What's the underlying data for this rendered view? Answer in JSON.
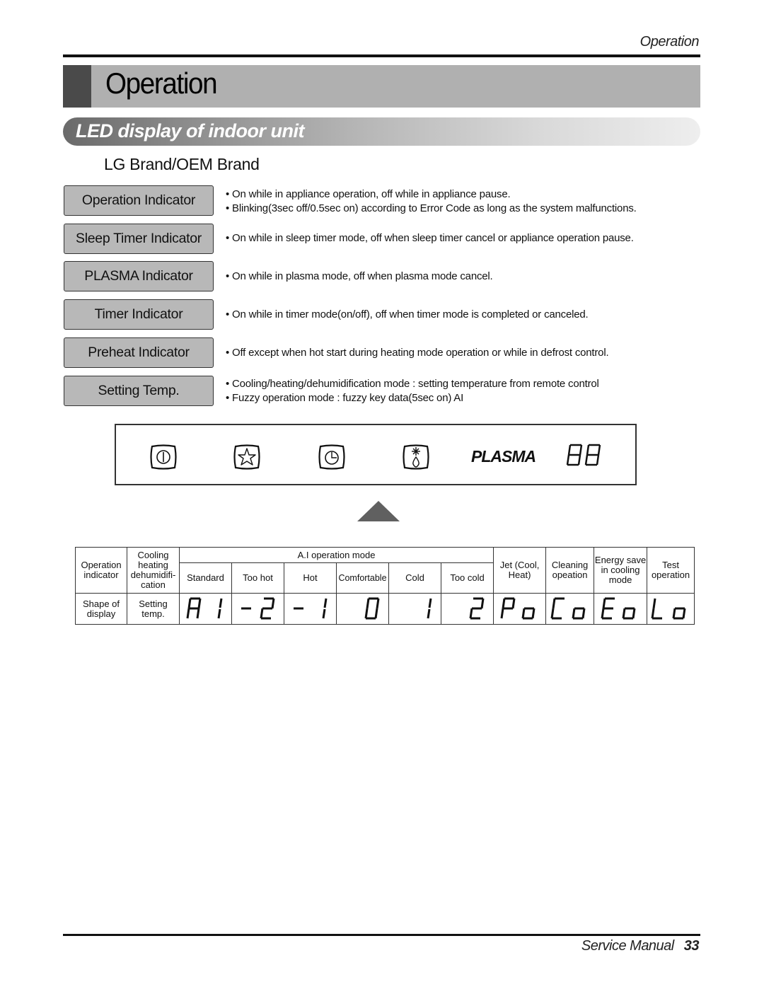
{
  "header": {
    "running_head": "Operation",
    "title": "Operation",
    "section": "LED display of indoor unit",
    "brand": "LG Brand/OEM Brand"
  },
  "indicators": [
    {
      "label": "Operation Indicator",
      "lines": [
        "• On while in appliance operation, off while in appliance pause.",
        "• Blinking(3sec off/0.5sec on) according to Error Code as long as the system malfunctions."
      ]
    },
    {
      "label": "Sleep Timer Indicator",
      "lines": [
        "• On while in sleep timer mode, off when sleep timer cancel or appliance operation pause."
      ]
    },
    {
      "label": "PLASMA Indicator",
      "lines": [
        "• On while in plasma mode, off when plasma mode cancel."
      ]
    },
    {
      "label": "Timer Indicator",
      "lines": [
        "• On while in timer mode(on/off), off when timer mode is completed or canceled."
      ]
    },
    {
      "label": "Preheat Indicator",
      "lines": [
        "• Off except when hot start during heating mode operation or while in defrost control."
      ]
    },
    {
      "label": "Setting Temp.",
      "lines": [
        "• Cooling/heating/dehumidification mode : setting temperature from remote control",
        "• Fuzzy operation mode : fuzzy key data(5sec on)     AI"
      ]
    }
  ],
  "panel": {
    "icons": [
      "power-icon",
      "sleep-star-icon",
      "timer-clock-icon",
      "preheat-icon"
    ],
    "plasma_label": "PLASMA",
    "digits": "88"
  },
  "table": {
    "row1": {
      "op_indicator": "Operation indicator",
      "cooling": "Cooling heating dehumidifi- cation",
      "ai_mode": "A.I operation mode",
      "jet": "Jet (Cool, Heat)",
      "cleaning": "Cleaning opeation",
      "energy": "Energy save in cooling mode",
      "test": "Test operation"
    },
    "ai_subheaders": [
      "Standard",
      "Too hot",
      "Hot",
      "Comfortable",
      "Cold",
      "Too cold"
    ],
    "row2": {
      "shape": "Shape of display",
      "setting": "Setting temp."
    },
    "displays": [
      "A1",
      "-2",
      "-1",
      "0",
      "1",
      "2",
      "Po",
      "Co",
      "Eo",
      "Lo"
    ]
  },
  "footer": {
    "label": "Service Manual",
    "page": "33"
  }
}
